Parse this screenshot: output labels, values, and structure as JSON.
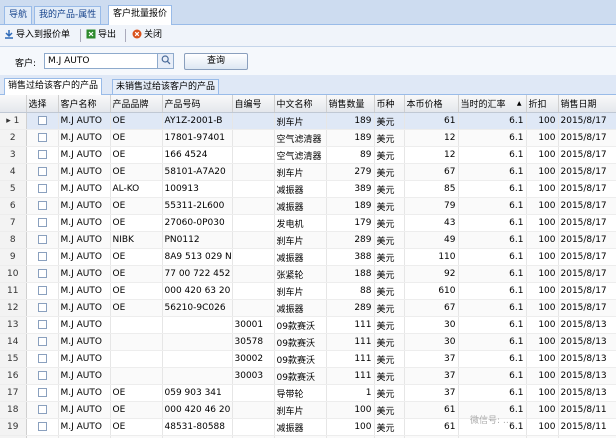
{
  "tabs": [
    "导航",
    "我的产品-属性",
    "客户批量报价"
  ],
  "toolbar": {
    "import_label": "导入到报价单",
    "export_label": "导出",
    "close_label": "关闭",
    "colors": {
      "import": "#2e6ab8",
      "export": "#2d8a2d",
      "close": "#d9531e"
    }
  },
  "search": {
    "customer_label": "客户:",
    "customer_value": "M.J AUTO",
    "query_label": "查询"
  },
  "subtabs": [
    "销售过给该客户的产品",
    "未销售过给该客户的产品"
  ],
  "grid": {
    "columns": [
      "",
      "选择",
      "客户名称",
      "产品品牌",
      "产品号码",
      "自编号",
      "中文名称",
      "销售数量",
      "币种",
      "本币价格",
      "当时的汇率",
      "折扣",
      "销售日期"
    ],
    "rows": [
      [
        "1",
        "",
        "M.J AUTO",
        "OE",
        "AY1Z-2001-B",
        "",
        "刹车片",
        "189",
        "美元",
        "61",
        "6.1",
        "100",
        "2015/8/17"
      ],
      [
        "2",
        "",
        "M.J AUTO",
        "OE",
        "17801-97401",
        "",
        "空气滤清器",
        "189",
        "美元",
        "12",
        "6.1",
        "100",
        "2015/8/17"
      ],
      [
        "3",
        "",
        "M.J AUTO",
        "OE",
        "166 4524",
        "",
        "空气滤清器",
        "89",
        "美元",
        "12",
        "6.1",
        "100",
        "2015/8/17"
      ],
      [
        "4",
        "",
        "M.J AUTO",
        "OE",
        "58101-A7A20",
        "",
        "刹车片",
        "279",
        "美元",
        "67",
        "6.1",
        "100",
        "2015/8/17"
      ],
      [
        "5",
        "",
        "M.J AUTO",
        "AL-KO",
        "100913",
        "",
        "减振器",
        "389",
        "美元",
        "85",
        "6.1",
        "100",
        "2015/8/17"
      ],
      [
        "6",
        "",
        "M.J AUTO",
        "OE",
        "55311-2L600",
        "",
        "减振器",
        "189",
        "美元",
        "79",
        "6.1",
        "100",
        "2015/8/17"
      ],
      [
        "7",
        "",
        "M.J AUTO",
        "OE",
        "27060-0P030",
        "",
        "发电机",
        "179",
        "美元",
        "43",
        "6.1",
        "100",
        "2015/8/17"
      ],
      [
        "8",
        "",
        "M.J AUTO",
        "NIBK",
        "PN0112",
        "",
        "刹车片",
        "289",
        "美元",
        "49",
        "6.1",
        "100",
        "2015/8/17"
      ],
      [
        "9",
        "",
        "M.J AUTO",
        "OE",
        "8A9 513 029 N",
        "",
        "减振器",
        "388",
        "美元",
        "110",
        "6.1",
        "100",
        "2015/8/17"
      ],
      [
        "10",
        "",
        "M.J AUTO",
        "OE",
        "77 00 722 452",
        "",
        "张紧轮",
        "188",
        "美元",
        "92",
        "6.1",
        "100",
        "2015/8/17"
      ],
      [
        "11",
        "",
        "M.J AUTO",
        "OE",
        "000 420 63 20",
        "",
        "刹车片",
        "88",
        "美元",
        "610",
        "6.1",
        "100",
        "2015/8/17"
      ],
      [
        "12",
        "",
        "M.J AUTO",
        "OE",
        "56210-9C026",
        "",
        "减振器",
        "289",
        "美元",
        "67",
        "6.1",
        "100",
        "2015/8/17"
      ],
      [
        "13",
        "",
        "M.J AUTO",
        "",
        "",
        "30001",
        "09款赛沃",
        "111",
        "美元",
        "30",
        "6.1",
        "100",
        "2015/8/13"
      ],
      [
        "14",
        "",
        "M.J AUTO",
        "",
        "",
        "30578",
        "09款赛沃",
        "111",
        "美元",
        "30",
        "6.1",
        "100",
        "2015/8/13"
      ],
      [
        "15",
        "",
        "M.J AUTO",
        "",
        "",
        "30002",
        "09款赛沃",
        "111",
        "美元",
        "37",
        "6.1",
        "100",
        "2015/8/13"
      ],
      [
        "16",
        "",
        "M.J AUTO",
        "",
        "",
        "30003",
        "09款赛沃",
        "111",
        "美元",
        "37",
        "6.1",
        "100",
        "2015/8/13"
      ],
      [
        "17",
        "",
        "M.J AUTO",
        "OE",
        "059 903 341",
        "",
        "导带轮",
        "1",
        "美元",
        "37",
        "6.1",
        "100",
        "2015/8/13"
      ],
      [
        "18",
        "",
        "M.J AUTO",
        "OE",
        "000 420 46 20",
        "",
        "刹车片",
        "100",
        "美元",
        "61",
        "6.1",
        "100",
        "2015/8/11"
      ],
      [
        "19",
        "",
        "M.J AUTO",
        "OE",
        "48531-80588",
        "",
        "减振器",
        "100",
        "美元",
        "61",
        "6.1",
        "100",
        "2015/8/11"
      ],
      [
        "20",
        "",
        "M.J AUTO",
        "OE",
        "124 320 01 30",
        "",
        "减振器",
        "100",
        "美元",
        "61",
        "6.1",
        "100",
        "2015/8/11"
      ]
    ]
  },
  "watermark": "微信号: …",
  "colors": {
    "header_bg": "#cddcf0",
    "grid_selected": "#dfe8f6"
  }
}
